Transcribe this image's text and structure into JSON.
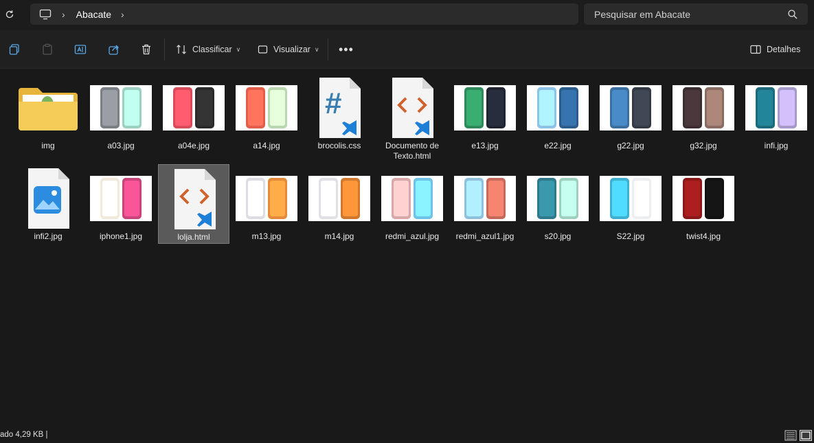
{
  "address": {
    "breadcrumb": "Abacate"
  },
  "search": {
    "placeholder": "Pesquisar em Abacate"
  },
  "toolbar": {
    "sort_label": "Classificar",
    "view_label": "Visualizar",
    "details_label": "Detalhes"
  },
  "files": [
    {
      "name": "img",
      "kind": "folder"
    },
    {
      "name": "a03.jpg",
      "kind": "image",
      "colors": [
        "#7a7f84",
        "#9ad1c0"
      ]
    },
    {
      "name": "a04e.jpg",
      "kind": "image",
      "colors": [
        "#d94a5a",
        "#2a2a2a"
      ]
    },
    {
      "name": "a14.jpg",
      "kind": "image",
      "colors": [
        "#e25d4a",
        "#b9d8b0"
      ]
    },
    {
      "name": "brocolis.css",
      "kind": "css"
    },
    {
      "name": "Documento de Texto.html",
      "kind": "html"
    },
    {
      "name": "e13.jpg",
      "kind": "image",
      "colors": [
        "#2e8a5a",
        "#1f2430"
      ]
    },
    {
      "name": "e22.jpg",
      "kind": "image",
      "colors": [
        "#8dc3e6",
        "#2b5c8c"
      ]
    },
    {
      "name": "g22.jpg",
      "kind": "image",
      "colors": [
        "#3a6fa0",
        "#333a44"
      ]
    },
    {
      "name": "g32.jpg",
      "kind": "image",
      "colors": [
        "#3b2d30",
        "#8b6c62"
      ]
    },
    {
      "name": "infi.jpg",
      "kind": "image",
      "colors": [
        "#1c6a7a",
        "#a89ac8"
      ]
    },
    {
      "name": "infi2.jpg",
      "kind": "photo-doc"
    },
    {
      "name": "iphone1.jpg",
      "kind": "image",
      "colors": [
        "#f1e9da",
        "#c9447a"
      ]
    },
    {
      "name": "lolja.html",
      "kind": "html",
      "selected": true
    },
    {
      "name": "m13.jpg",
      "kind": "image",
      "colors": [
        "#dddde3",
        "#e48a3a"
      ]
    },
    {
      "name": "m14.jpg",
      "kind": "image",
      "colors": [
        "#e0e0e6",
        "#d0782e"
      ]
    },
    {
      "name": "redmi_azul.jpg",
      "kind": "image",
      "colors": [
        "#d8a8a8",
        "#6fc2e8"
      ]
    },
    {
      "name": "redmi_azul1.jpg",
      "kind": "image",
      "colors": [
        "#8fc0dc",
        "#c56a5a"
      ]
    },
    {
      "name": "s20.jpg",
      "kind": "image",
      "colors": [
        "#2f7a8a",
        "#9ed0c0"
      ]
    },
    {
      "name": "S22.jpg",
      "kind": "image",
      "colors": [
        "#3fb0d0",
        "#eceef0"
      ]
    },
    {
      "name": "twist4.jpg",
      "kind": "image",
      "colors": [
        "#8a1818",
        "#111111"
      ]
    }
  ],
  "status": {
    "text": "ado  4,29 KB  |"
  }
}
